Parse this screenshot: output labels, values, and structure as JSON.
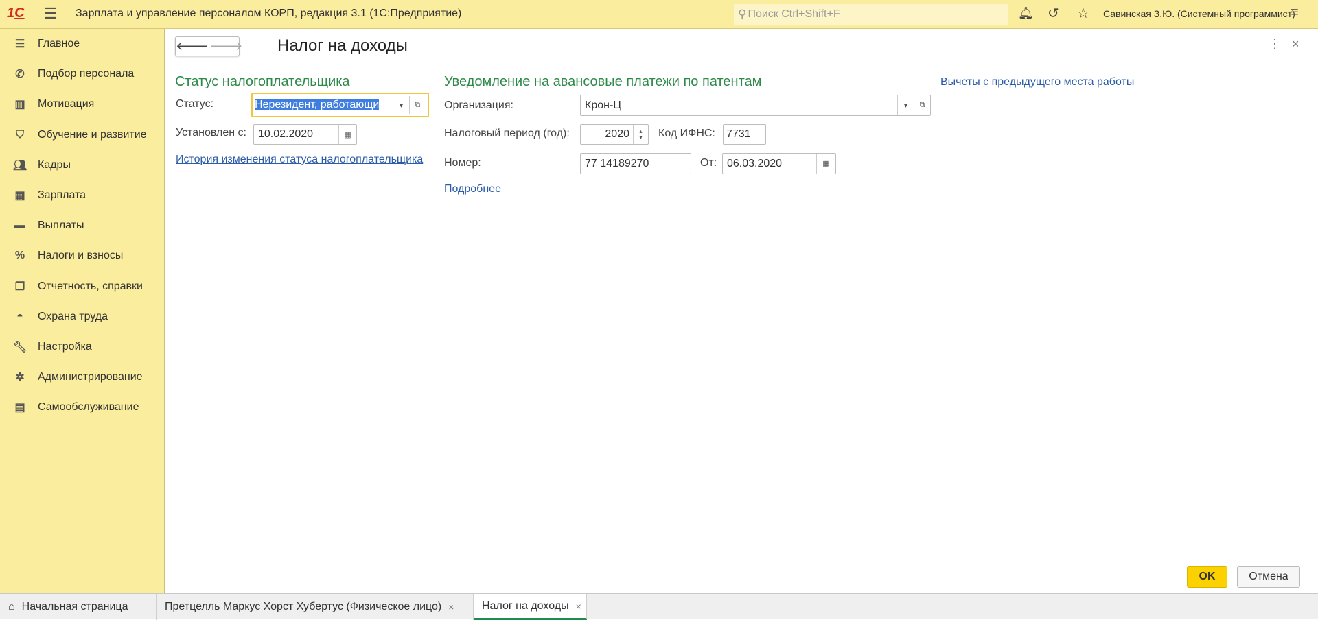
{
  "app": {
    "title": "Зарплата и управление персоналом КОРП, редакция 3.1  (1С:Предприятие)",
    "search_placeholder": "Поиск Ctrl+Shift+F",
    "user": "Савинская З.Ю. (Системный программист)",
    "logo": "1С"
  },
  "sidebar": {
    "items": [
      {
        "label": "Главное",
        "icon": "list-icon"
      },
      {
        "label": "Подбор персонала",
        "icon": "phone-icon"
      },
      {
        "label": "Мотивация",
        "icon": "gift-icon"
      },
      {
        "label": "Обучение и развитие",
        "icon": "graduation-cap-icon"
      },
      {
        "label": "Кадры",
        "icon": "people-icon"
      },
      {
        "label": "Зарплата",
        "icon": "calculator-icon"
      },
      {
        "label": "Выплаты",
        "icon": "card-icon"
      },
      {
        "label": "Налоги и взносы",
        "icon": "percent-icon"
      },
      {
        "label": "Отчетность, справки",
        "icon": "documents-icon"
      },
      {
        "label": "Охрана труда",
        "icon": "helmet-icon"
      },
      {
        "label": "Настройка",
        "icon": "wrench-icon"
      },
      {
        "label": "Администрирование",
        "icon": "gear-icon"
      },
      {
        "label": "Самообслуживание",
        "icon": "id-card-icon"
      }
    ]
  },
  "form": {
    "title": "Налог на доходы",
    "status_section": {
      "heading": "Статус налогоплательщика",
      "status_label": "Статус:",
      "status_value": "Нерезидент, работающи",
      "since_label": "Установлен с:",
      "since_value": "10.02.2020",
      "history_link": "История изменения статуса налогоплательщика"
    },
    "patent_section": {
      "heading": "Уведомление на авансовые платежи по патентам",
      "org_label": "Организация:",
      "org_value": "Крон-Ц",
      "period_label": "Налоговый период (год):",
      "period_value": "2020",
      "ifns_label": "Код ИФНС:",
      "ifns_value": "7731",
      "number_label": "Номер:",
      "number_value": "77 14189270",
      "from_label": "От:",
      "from_value": "06.03.2020",
      "more_link": "Подробнее"
    },
    "deductions_link": "Вычеты с предыдущего места работы",
    "ok_label": "OK",
    "cancel_label": "Отмена"
  },
  "tabs": [
    {
      "label": "Начальная страница"
    },
    {
      "label": "Претцелль Маркус Хорст Хубертус (Физическое лицо)"
    },
    {
      "label": "Налог на доходы",
      "active": true
    }
  ]
}
